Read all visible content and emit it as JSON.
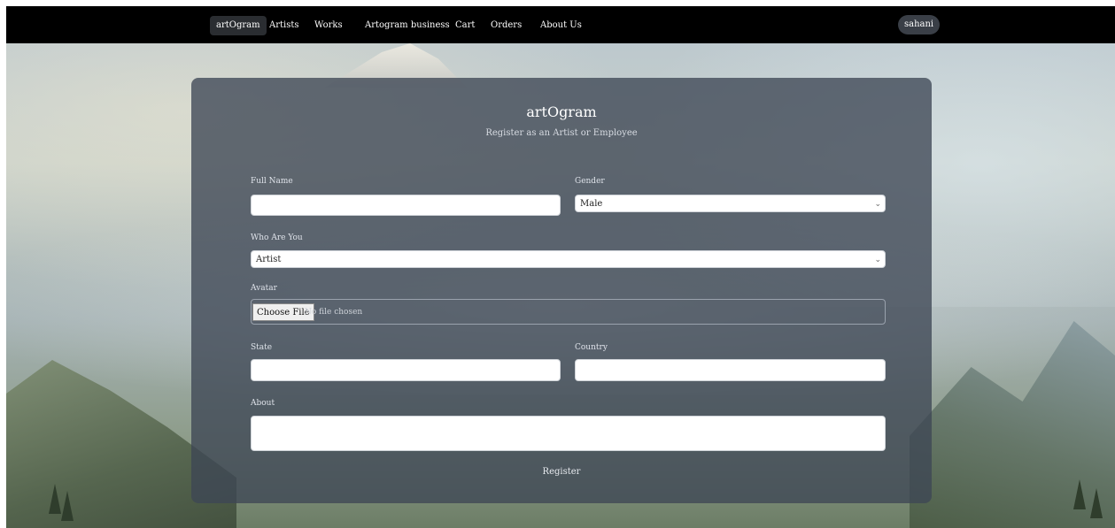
{
  "nav": {
    "items": [
      {
        "label": "artOgram",
        "active": true
      },
      {
        "label": "Artists",
        "active": false
      },
      {
        "label": "Works",
        "active": false
      },
      {
        "label": "Artogram business",
        "active": false
      },
      {
        "label": "Cart",
        "active": false
      },
      {
        "label": "Orders",
        "active": false
      },
      {
        "label": "About Us",
        "active": false
      }
    ],
    "user": "sahani"
  },
  "form": {
    "brand": "artOgram",
    "subtitle": "Register as an Artist or Employee",
    "full_name": {
      "label": "Full Name",
      "value": ""
    },
    "gender": {
      "label": "Gender",
      "selected": "Male"
    },
    "role": {
      "label": "Who Are You",
      "selected": "Artist"
    },
    "avatar": {
      "label": "Avatar",
      "button": "Choose File",
      "status": "No file chosen"
    },
    "state": {
      "label": "State",
      "value": ""
    },
    "country": {
      "label": "Country",
      "value": ""
    },
    "about": {
      "label": "About",
      "value": ""
    },
    "submit": "Register"
  },
  "colors": {
    "navbar": "#000000",
    "card": "#3e4654",
    "text": "#ffffff"
  }
}
